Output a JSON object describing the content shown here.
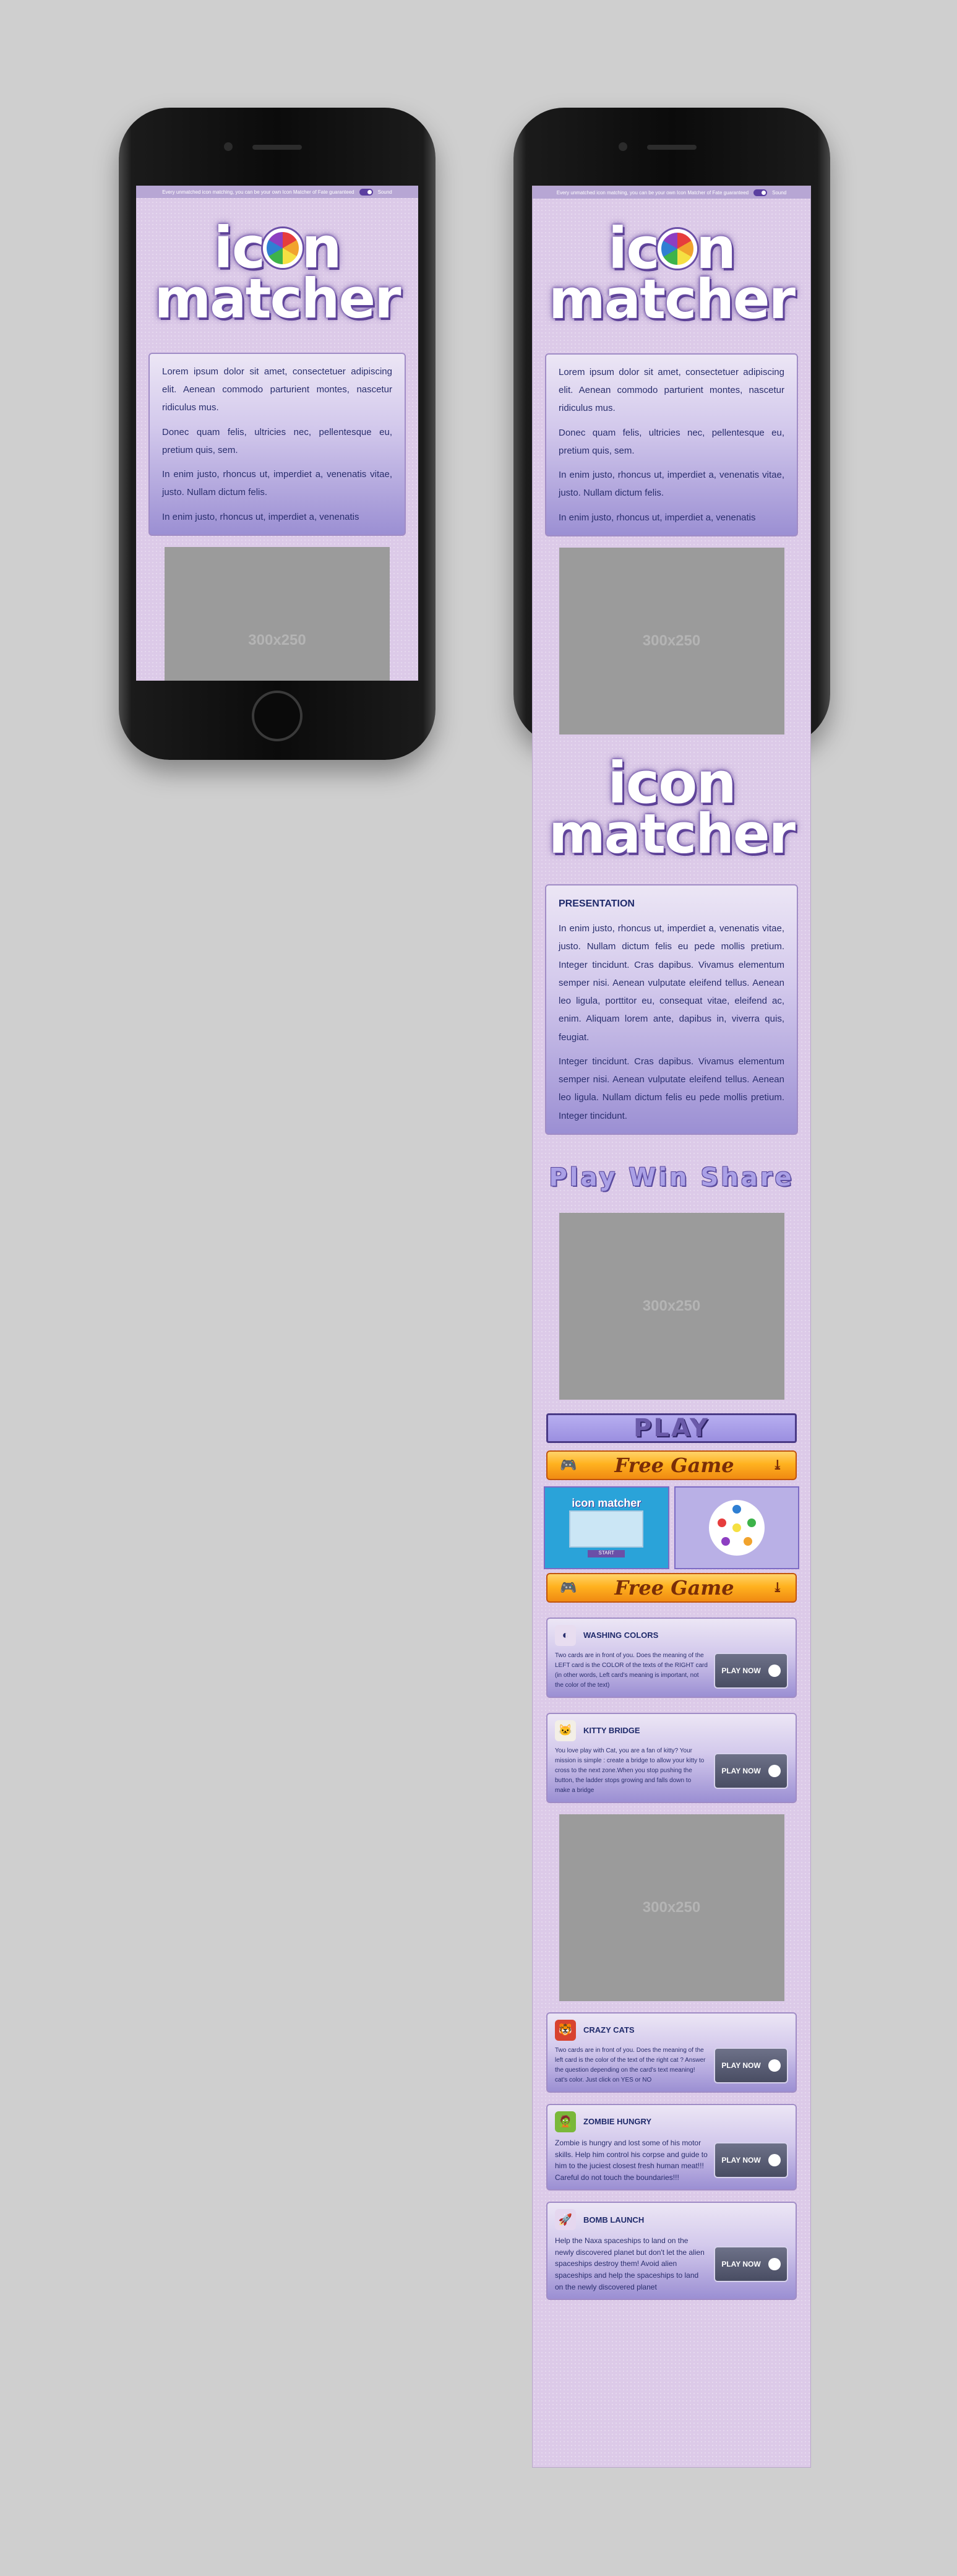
{
  "topbar": {
    "text": "Every unmatched icon matching, you can be your own Icon Matcher of Fate guaranteed",
    "mute_label": "Sound"
  },
  "logo": {
    "line1_a": "ic",
    "line1_b": "n",
    "line2": "matcher"
  },
  "intro": {
    "paragraphs": [
      "Lorem ipsum dolor sit amet, consectetuer adipiscing elit. Aenean commodo parturient montes, nascetur ridiculus mus.",
      "Donec quam felis, ultricies nec, pellentesque eu, pretium quis, sem.",
      "In enim justo, rhoncus ut, imperdiet a, venenatis vitae, justo. Nullam dictum felis.",
      "In enim justo, rhoncus ut, imperdiet a, venenatis"
    ]
  },
  "ad_label": "300x250",
  "logo2": {
    "line1": "icon",
    "line2": "matcher"
  },
  "presentation": {
    "title": "PRESENTATION",
    "p1": "In enim justo, rhoncus ut, imperdiet a, venenatis vitae, justo. Nullam dictum felis eu pede mollis pretium. Integer tincidunt. Cras dapibus. Vivamus elementum semper nisi. Aenean vulputate eleifend tellus. Aenean leo ligula, porttitor eu, consequat vitae, eleifend ac, enim. Aliquam lorem ante, dapibus in, viverra quis, feugiat.",
    "p2": "Integer tincidunt. Cras dapibus. Vivamus elementum semper nisi. Aenean vulputate eleifend tellus. Aenean leo ligula. Nullam dictum felis eu pede mollis pretium. Integer tincidunt."
  },
  "tagline": "Play Win Share",
  "play_label": "PLAY",
  "free_game_label": "Free Game",
  "shot_mini": {
    "logo": "icon matcher",
    "start": "START"
  },
  "games": [
    {
      "title": "WASHING COLORS",
      "icon": "washing-colors-icon",
      "icon_bg": "#e8ddf0",
      "glyph": "◐",
      "desc": "Two cards are in front of you. Does the meaning of the LEFT card is the COLOR of the texts of the RIGHT card (in other words, Left card's meaning is important, not the color of the text)",
      "button": "PLAY NOW"
    },
    {
      "title": "KITTY BRIDGE",
      "icon": "kitty-bridge-icon",
      "icon_bg": "#f3efe6",
      "glyph": "🐱",
      "desc": "You love play with Cat, you are a fan of kitty? Your mission is simple : create a bridge to allow your kitty to cross to the next zone.When you stop pushing the button, the ladder stops growing and falls down to make a bridge",
      "button": "PLAY NOW"
    },
    {
      "title": "CRAZY CATS",
      "icon": "crazy-cats-icon",
      "icon_bg": "#d8432f",
      "glyph": "🐯",
      "desc": "Two cards are in front of you. Does the meaning of the left card is the color of the text of the right cat ? Answer the question depending on the card's text meaning! cat's color. Just click on YES or NO",
      "button": "PLAY NOW"
    },
    {
      "title": "ZOMBIE HUNGRY",
      "icon": "zombie-hungry-icon",
      "icon_bg": "#7ab83a",
      "glyph": "🧟",
      "desc": "Zombie is hungry and lost some of his motor skills. Help him control his corpse and guide to him to the juciest closest fresh human meat!!! Careful do not touch the boundaries!!!",
      "button": "PLAY NOW"
    },
    {
      "title": "BOMB LAUNCH",
      "icon": "bomb-launch-icon",
      "icon_bg": "#e5d7ef",
      "glyph": "🚀",
      "desc": "Help the Naxa spaceships to land on the newly discovered planet but don't let the alien spaceships destroy them! Avoid alien spaceships and help the spaceships to land on the newly discovered planet",
      "button": "PLAY NOW"
    }
  ],
  "colors": {
    "bg": "#cfcfcf",
    "screen": "#dccae8",
    "card_end": "#9b8fd3",
    "accent": "#5a3f93",
    "orange": "#ffb21f"
  }
}
